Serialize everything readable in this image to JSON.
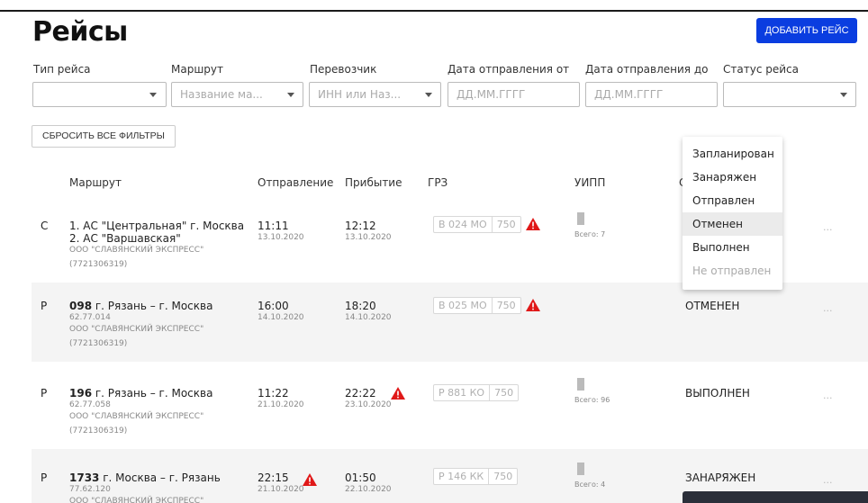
{
  "page": {
    "title": "Рейсы",
    "add_button": "ДОБАВИТЬ РЕЙС",
    "reset_button": "СБРОСИТЬ ВСЕ ФИЛЬТРЫ"
  },
  "filters": {
    "trip_type": {
      "label": "Тип рейса",
      "value": ""
    },
    "route": {
      "label": "Маршрут",
      "placeholder": "Название ма..."
    },
    "carrier": {
      "label": "Перевозчик",
      "placeholder": "ИНН или Наз..."
    },
    "date_from": {
      "label": "Дата отправления от",
      "placeholder": "ДД.ММ.ГГГГ"
    },
    "date_to": {
      "label": "Дата отправления до",
      "placeholder": "ДД.ММ.ГГГГ"
    },
    "status": {
      "label": "Статус рейса",
      "value": ""
    }
  },
  "table": {
    "headers": {
      "route": "Маршрут",
      "departure": "Отправление",
      "arrival": "Прибытие",
      "grz": "ГРЗ",
      "uipp": "УИПП",
      "status": "С"
    },
    "rows": [
      {
        "type": "С",
        "route_line1": "1. АС \"Центральная\" г. Москва",
        "route_line2": "2. АС \"Варшавская\"",
        "company": "ООО \"СЛАВЯНСКИЙ ЭКСПРЕСС\"",
        "inn": "(7721306319)",
        "dep_time": "11:11",
        "dep_date": "13.10.2020",
        "arr_time": "12:12",
        "arr_date": "13.10.2020",
        "plate_num": "В 024 МО",
        "plate_reg": "750",
        "uipp_total": "Всего: 7",
        "status": "",
        "more": "..."
      },
      {
        "type": "Р",
        "route_num": "098",
        "route_name": " г. Рязань – г. Москва",
        "route_code": "62.77.014",
        "company": "ООО \"СЛАВЯНСКИЙ ЭКСПРЕСС\"",
        "inn": "(7721306319)",
        "dep_time": "16:00",
        "dep_date": "14.10.2020",
        "arr_time": "18:20",
        "arr_date": "14.10.2020",
        "plate_num": "В 025 МО",
        "plate_reg": "750",
        "status": "ОТМЕНЕН",
        "more": "..."
      },
      {
        "type": "Р",
        "route_num": "196",
        "route_name": " г. Рязань – г. Москва",
        "route_code": "62.77.058",
        "company": "ООО \"СЛАВЯНСКИЙ ЭКСПРЕСС\"",
        "inn": "(7721306319)",
        "dep_time": "11:22",
        "dep_date": "21.10.2020",
        "arr_time": "22:22",
        "arr_date": "23.10.2020",
        "plate_num": "Р 881 КО",
        "plate_reg": "750",
        "uipp_total": "Всего: 96",
        "status": "ВЫПОЛНЕН",
        "more": "..."
      },
      {
        "type": "Р",
        "route_num": "1733",
        "route_name": " г. Москва – г. Рязань",
        "route_code": "77.62.120",
        "company": "ООО \"СЛАВЯНСКИЙ ЭКСПРЕСС\"",
        "dep_time": "22:15",
        "dep_date": "21.10.2020",
        "arr_time": "01:50",
        "arr_date": "22.10.2020",
        "plate_num": "Р 146 КК",
        "plate_reg": "750",
        "uipp_total": "Всего: 4",
        "status": "ЗАНАРЯЖЕН",
        "more": "..."
      }
    ]
  },
  "status_dropdown": {
    "options": [
      "Запланирован",
      "Занаряжен",
      "Отправлен",
      "Отменен",
      "Выполнен",
      "Не отправлен"
    ],
    "highlighted": "Отменен",
    "disabled": "Не отправлен"
  },
  "colors": {
    "primary": "#0a3de0",
    "warning": "#e01818",
    "row_alt": "#f4f4f4"
  },
  "icons": {
    "warning": "warning-triangle-icon",
    "dropdown": "chevron-down-icon"
  }
}
